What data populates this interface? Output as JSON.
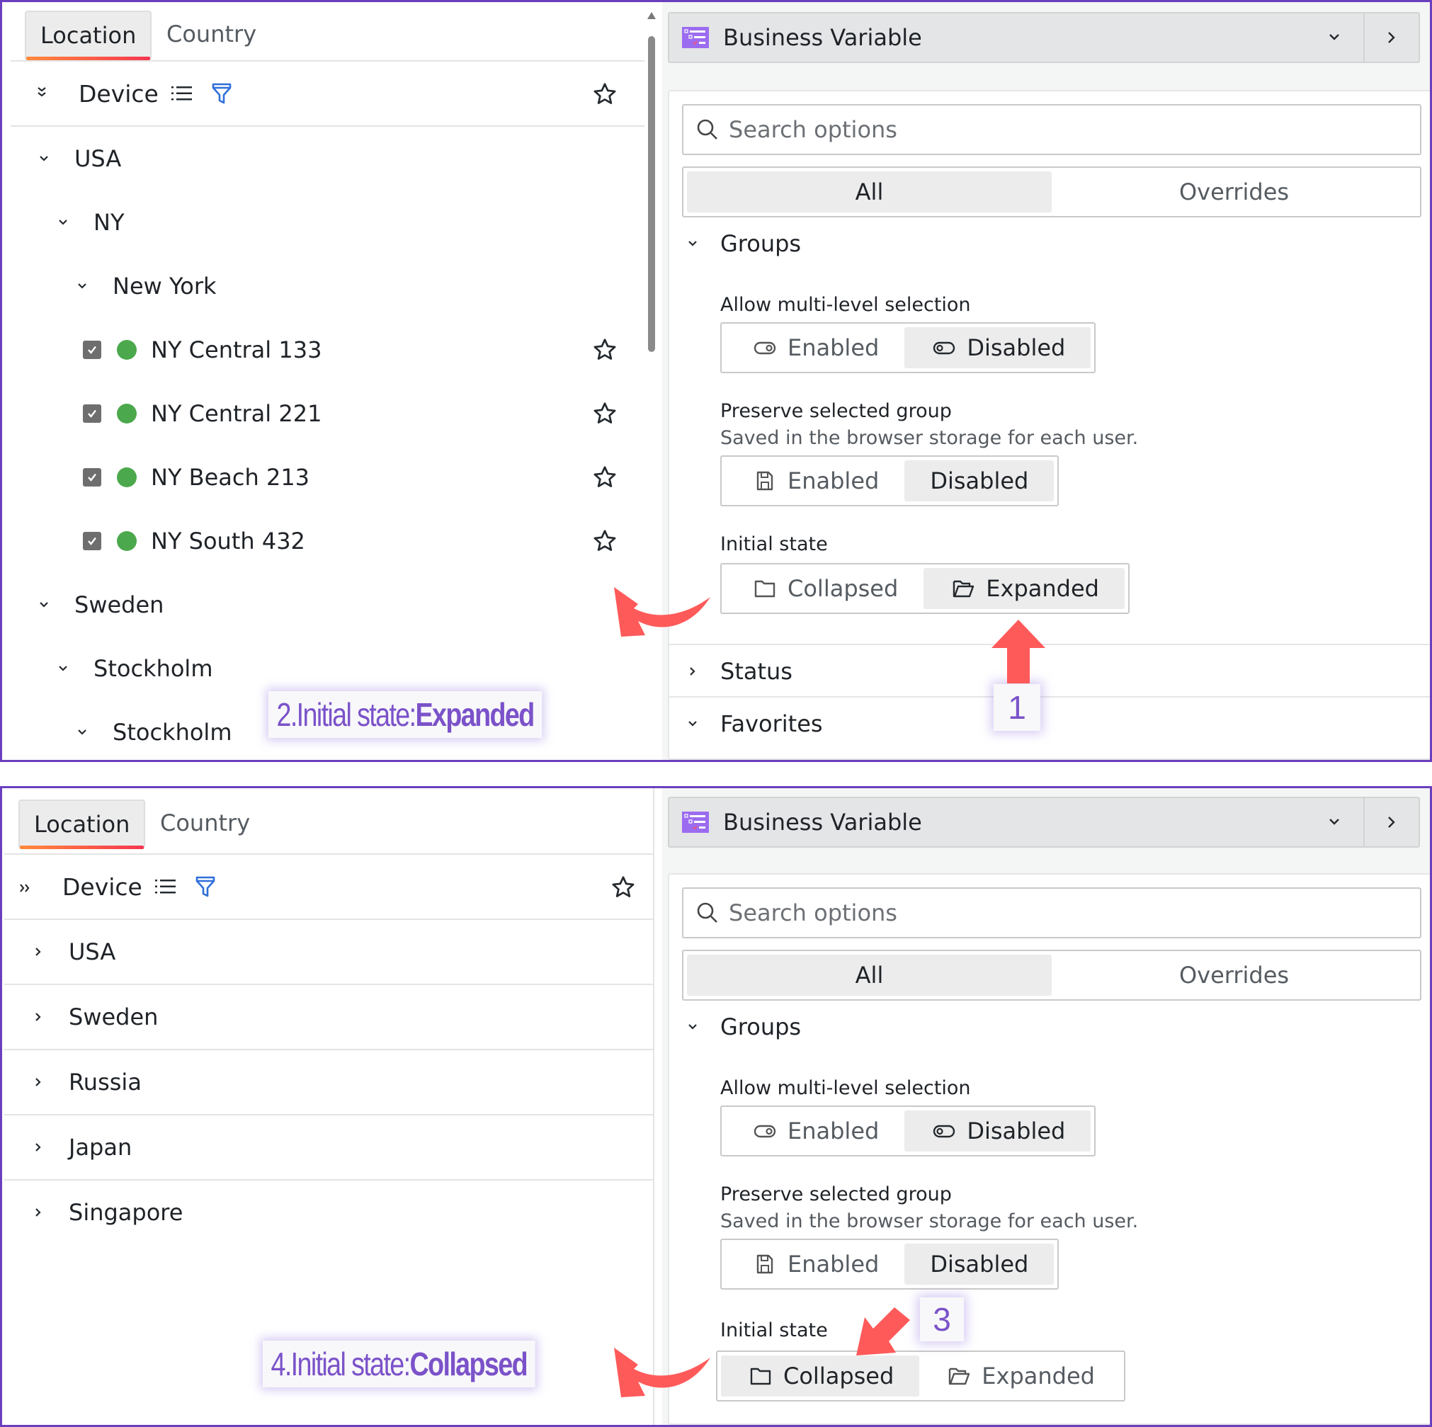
{
  "screens": {
    "expanded": {
      "tabs": [
        {
          "label": "Location",
          "active": true
        },
        {
          "label": "Country",
          "active": false
        }
      ],
      "device_header": {
        "label": "Device"
      },
      "tree": [
        {
          "label": "USA",
          "level": 0,
          "expanded": true
        },
        {
          "label": "NY",
          "level": 1,
          "expanded": true
        },
        {
          "label": "New York",
          "level": 2,
          "expanded": true
        },
        {
          "label": "NY Central 133",
          "level": 3,
          "checked": true,
          "status": "online"
        },
        {
          "label": "NY Central 221",
          "level": 3,
          "checked": true,
          "status": "online"
        },
        {
          "label": "NY Beach 213",
          "level": 3,
          "checked": true,
          "status": "online"
        },
        {
          "label": "NY South 432",
          "level": 3,
          "checked": true,
          "status": "online"
        },
        {
          "label": "Sweden",
          "level": 0,
          "expanded": true
        },
        {
          "label": "Stockholm",
          "level": 1,
          "expanded": true
        },
        {
          "label": "Stockholm",
          "level": 2,
          "expanded": true
        }
      ],
      "annotation": {
        "prefix": "2.Initial state: ",
        "value": "Expanded"
      },
      "step_badge": "1"
    },
    "collapsed": {
      "tabs": [
        {
          "label": "Location",
          "active": true
        },
        {
          "label": "Country",
          "active": false
        }
      ],
      "device_header": {
        "label": "Device"
      },
      "tree": [
        {
          "label": "USA",
          "level": 0,
          "expanded": false
        },
        {
          "label": "Sweden",
          "level": 0,
          "expanded": false
        },
        {
          "label": "Russia",
          "level": 0,
          "expanded": false
        },
        {
          "label": "Japan",
          "level": 0,
          "expanded": false
        },
        {
          "label": "Singapore",
          "level": 0,
          "expanded": false
        }
      ],
      "annotation": {
        "prefix": "4.Initial state: ",
        "value": "Collapsed"
      },
      "step_badge": "3"
    }
  },
  "settings_panel": {
    "title": "Business Variable",
    "search_placeholder": "Search options",
    "filter_tabs": [
      {
        "label": "All",
        "selected": true
      },
      {
        "label": "Overrides",
        "selected": false
      }
    ],
    "groups_section": {
      "title": "Groups",
      "multi_level": {
        "label": "Allow multi-level selection",
        "options": [
          "Enabled",
          "Disabled"
        ],
        "selected": "Disabled"
      },
      "preserve": {
        "label": "Preserve selected group",
        "hint": "Saved in the browser storage for each user.",
        "options": [
          "Enabled",
          "Disabled"
        ],
        "selected": "Disabled"
      },
      "initial_state": {
        "label": "Initial state",
        "options": [
          "Collapsed",
          "Expanded"
        ]
      }
    },
    "status_section": {
      "title": "Status"
    },
    "favorites_section": {
      "title": "Favorites"
    }
  },
  "colors": {
    "accent_border": "#6a3fbf",
    "annotation_text": "#7b52c9",
    "arrow": "#ff5a5a",
    "status_online": "#4ca84c",
    "filter_icon": "#2f6fdb",
    "tab_underline_start": "#ff8a3d",
    "tab_underline_end": "#f5364f"
  }
}
